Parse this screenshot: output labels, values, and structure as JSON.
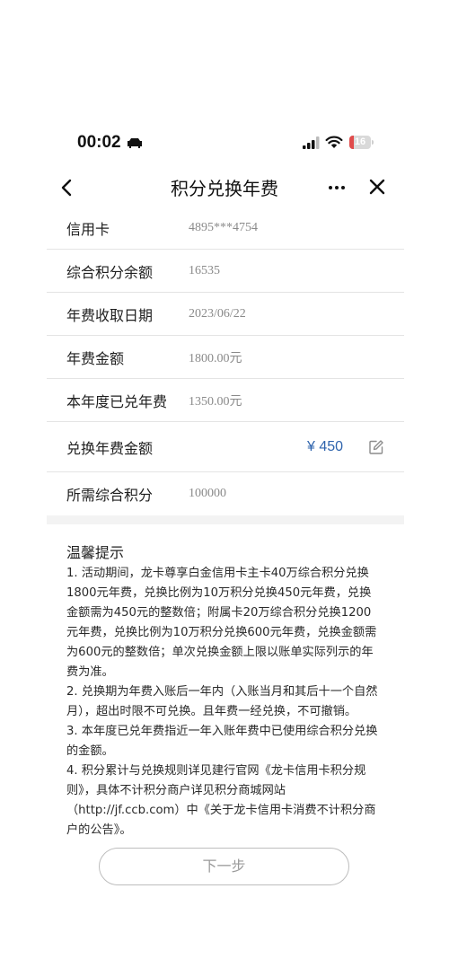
{
  "status_bar": {
    "time": "00:02",
    "battery": "16",
    "battery_color": "#e04b4b"
  },
  "nav": {
    "title": "积分兑换年费",
    "back_icon": "chevron-left-icon",
    "more_icon": "more-dots-icon",
    "close_icon": "close-icon"
  },
  "rows": [
    {
      "label": "信用卡",
      "value": "4895***4754"
    },
    {
      "label": "综合积分余额",
      "value": "16535"
    },
    {
      "label": "年费收取日期",
      "value": "2023/06/22"
    },
    {
      "label": "年费金额",
      "value": "1800.00元"
    },
    {
      "label": "本年度已兑年费",
      "value": "1350.00元"
    },
    {
      "label": "兑换年费金额",
      "amount": "¥ 450",
      "edit_icon": "edit-icon"
    },
    {
      "label": "所需综合积分",
      "value": "100000"
    }
  ],
  "tips": {
    "title": "温馨提示",
    "items": [
      "1. 活动期间，龙卡尊享白金信用卡主卡40万综合积分兑换1800元年费，兑换比例为10万积分兑换450元年费，兑换金额需为450元的整数倍；附属卡20万综合积分兑换1200元年费，兑换比例为10万积分兑换600元年费，兑换金额需为600元的整数倍；单次兑换金额上限以账单实际列示的年费为准。",
      "2. 兑换期为年费入账后一年内（入账当月和其后十一个自然月），超出时限不可兑换。且年费一经兑换，不可撤销。",
      "3. 本年度已兑年费指近一年入账年费中已使用综合积分兑换的金额。",
      "4. 积分累计与兑换规则详见建行官网《龙卡信用卡积分规则》，具体不计积分商户详见积分商城网站（http://jf.ccb.com）中《关于龙卡信用卡消费不计积分商户的公告》。"
    ]
  },
  "button": {
    "next_label": "下一步"
  },
  "colors": {
    "accent": "#2f64ad"
  }
}
